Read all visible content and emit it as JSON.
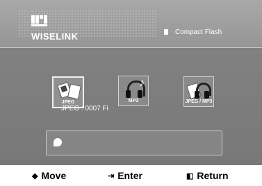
{
  "header": {
    "brand": "WISELINK",
    "device": "Compact Flash"
  },
  "menu": {
    "items": [
      {
        "label": "JPEG",
        "icon": "photo-icon"
      },
      {
        "label": "MP3",
        "icon": "headphones-music-icon"
      },
      {
        "label": "JPEG / MP3",
        "icon": "photo-headphones-icon"
      }
    ],
    "selected": "JPEG",
    "overlay_text": "JPEG : 0007 Fi"
  },
  "footer": {
    "move": "Move",
    "enter": "Enter",
    "return": "Return"
  },
  "colors": {
    "background": "#808080",
    "highlight": "#f0f0f0",
    "text": "#ffffff"
  }
}
